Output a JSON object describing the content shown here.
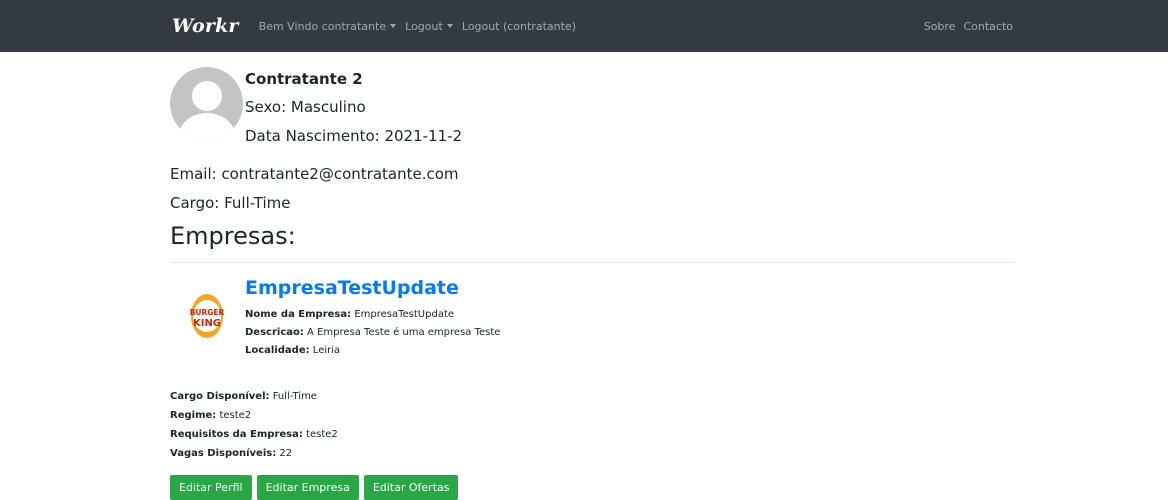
{
  "navbar": {
    "brand": "Workr",
    "links": [
      "Bem Vindo contratante",
      "Logout",
      "Logout (contratante)"
    ],
    "right_links": [
      "Sobre",
      "Contacto"
    ]
  },
  "profile": {
    "name": "Contratante 2",
    "sexo": "Sexo: Masculino",
    "data_nascimento": "Data Nascimento: 2021-11-2",
    "email": "Email: contratante2@contratante.com",
    "cargo": "Cargo: Full-Time"
  },
  "section_title": "Empresas:",
  "empresa": {
    "title": "EmpresaTestUpdate",
    "logo_text_top": "BURGER",
    "logo_text_bottom": "KING",
    "nome_label": "Nome da Empresa:",
    "nome_value": " EmpresaTestUpdate",
    "descricao_label": "Descricao:",
    "descricao_value": " A Empresa Teste é uma empresa Teste",
    "localidade_label": "Localidade:",
    "localidade_value": " Leiria",
    "cargo_label": "Cargo Disponível:",
    "cargo_value": " Full-Time",
    "regime_label": "Regime:",
    "regime_value": " teste2",
    "requisitos_label": "Requisitos da Empresa:",
    "requisitos_value": " teste2",
    "vagas_label": "Vagas Disponíveis:",
    "vagas_value": " 22"
  },
  "buttons": {
    "editar_perfil": "Editar Perfil",
    "editar_empresa": "Editar Empresa",
    "editar_ofertas": "Editar Ofertas"
  },
  "colors": {
    "navbar": "#343a40",
    "link": "#007bff",
    "button": "#28a745"
  }
}
